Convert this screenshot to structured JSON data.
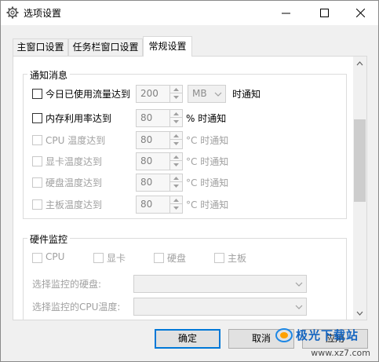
{
  "window": {
    "title": "选项设置",
    "icon": "gear-icon"
  },
  "tabs": [
    {
      "label": "主窗口设置",
      "active": false
    },
    {
      "label": "任务栏窗口设置",
      "active": false
    },
    {
      "label": "常规设置",
      "active": true
    }
  ],
  "notify": {
    "legend": "通知消息",
    "traffic": {
      "label": "今日已使用流量达到",
      "value": "200",
      "unit": "MB",
      "suffix": "时通知",
      "checked": false,
      "enabled": true
    },
    "memory": {
      "label": "内存利用率达到",
      "value": "80",
      "suffix": "% 时通知",
      "checked": false,
      "enabled": true
    },
    "cpu_temp": {
      "label": "CPU 温度达到",
      "value": "80",
      "suffix": "°C 时通知",
      "checked": false,
      "enabled": false
    },
    "gpu_temp": {
      "label": "显卡温度达到",
      "value": "80",
      "suffix": "°C 时通知",
      "checked": false,
      "enabled": false
    },
    "disk_temp": {
      "label": "硬盘温度达到",
      "value": "80",
      "suffix": "°C 时通知",
      "checked": false,
      "enabled": false
    },
    "board_temp": {
      "label": "主板温度达到",
      "value": "80",
      "suffix": "°C 时通知",
      "checked": false,
      "enabled": false
    }
  },
  "hardware": {
    "legend": "硬件监控",
    "cpu": "CPU",
    "gpu": "显卡",
    "disk": "硬盘",
    "board": "主板",
    "select_disk": {
      "label": "选择监控的硬盘:",
      "value": ""
    },
    "select_cpu": {
      "label": "选择监控的CPU温度:",
      "value": ""
    }
  },
  "buttons": {
    "ok": "确定",
    "cancel": "取消",
    "apply": "应用"
  },
  "watermark": {
    "brand": "极光下载站",
    "url": "www.xz7.com"
  },
  "colors": {
    "accent": "#0078d7",
    "disabled_text": "#a0a0a0"
  }
}
